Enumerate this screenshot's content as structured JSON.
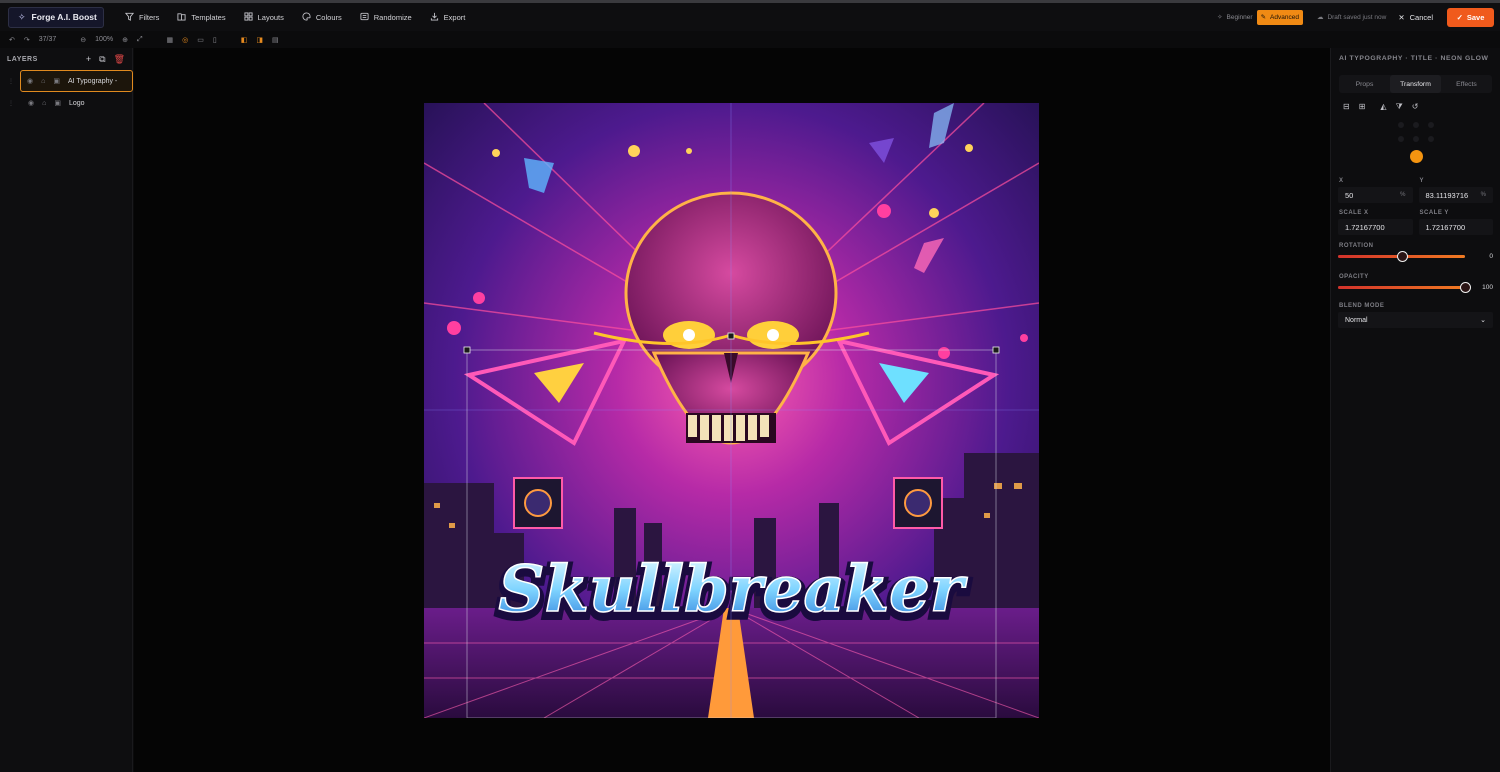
{
  "app": {
    "brand": "Forge A.I. Boost",
    "menu": [
      {
        "label": "Filters",
        "icon": "filter-icon"
      },
      {
        "label": "Templates",
        "icon": "template-icon"
      },
      {
        "label": "Layouts",
        "icon": "grid-icon"
      },
      {
        "label": "Colours",
        "icon": "palette-icon"
      },
      {
        "label": "Randomize",
        "icon": "shuffle-icon"
      },
      {
        "label": "Export",
        "icon": "export-icon"
      }
    ],
    "modes": {
      "beginner": "Beginner",
      "advanced": "Advanced"
    },
    "draft_status": "Draft saved just now",
    "cancel_label": "Cancel",
    "save_label": "Save",
    "accent": "#f08a14",
    "save_color": "#f05a1c"
  },
  "toolbar": {
    "history": "37/37",
    "zoom": "100%"
  },
  "layers": {
    "title": "LAYERS",
    "items": [
      {
        "label": "AI Typography -",
        "selected": true
      },
      {
        "label": "Logo",
        "selected": false
      }
    ]
  },
  "canvas": {
    "artwork_title": "Skullbreaker"
  },
  "inspector": {
    "title": "AI TYPOGRAPHY · TITLE · NEON GLOW",
    "tabs": [
      "Props",
      "Transform",
      "Effects"
    ],
    "active_tab": "Transform",
    "x_label": "X",
    "x_value": "50",
    "y_label": "Y",
    "y_value": "83.11193716",
    "unit": "%",
    "scale_x_label": "SCALE X",
    "scale_x_value": "1.72167700",
    "scale_y_label": "SCALE Y",
    "scale_y_value": "1.72167700",
    "rotation_label": "ROTATION",
    "rotation_value": "0",
    "rotation_fraction": 0.5,
    "opacity_label": "OPACITY",
    "opacity_value": "100",
    "opacity_fraction": 1.0,
    "blend_label": "BLEND MODE",
    "blend_value": "Normal"
  }
}
